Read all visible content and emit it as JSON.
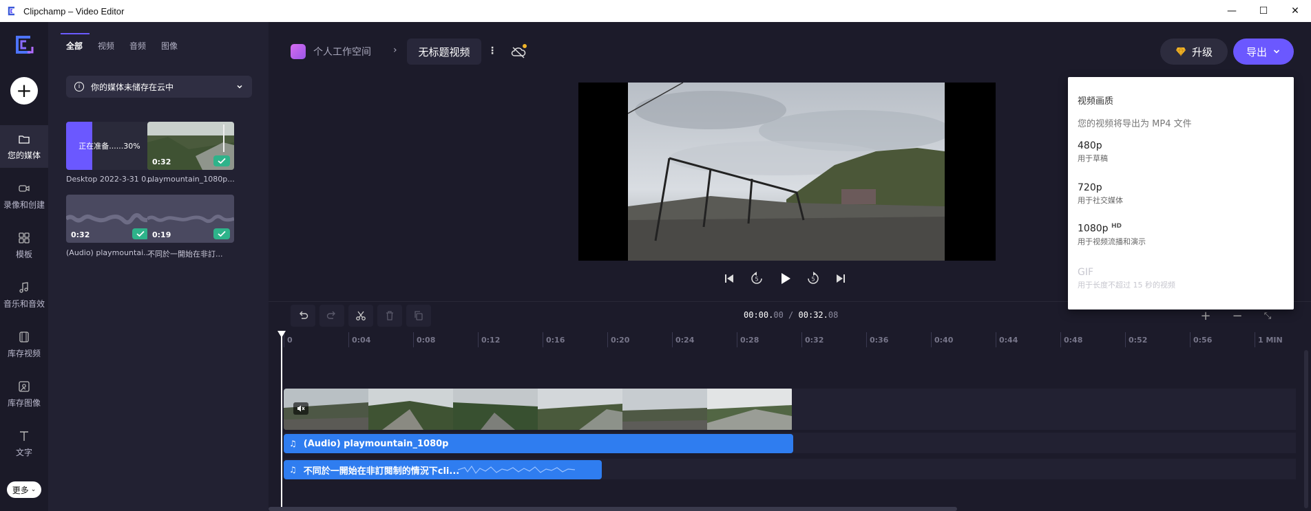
{
  "window": {
    "title": "Clipchamp – Video Editor",
    "minimize": "—",
    "maximize": "☐",
    "close": "✕"
  },
  "rail": {
    "items": [
      {
        "label": "您的媒体",
        "icon": "folder-icon"
      },
      {
        "label": "录像和创建",
        "icon": "camera-icon"
      },
      {
        "label": "模板",
        "icon": "templates-icon"
      },
      {
        "label": "音乐和音效",
        "icon": "music-icon"
      },
      {
        "label": "库存视频",
        "icon": "film-icon"
      },
      {
        "label": "库存图像",
        "icon": "image-icon"
      },
      {
        "label": "文字",
        "icon": "text-icon"
      }
    ],
    "more_label": "更多"
  },
  "media": {
    "tabs": [
      "全部",
      "视频",
      "音频",
      "图像"
    ],
    "cloud_banner": "你的媒体未储存在云中",
    "items": [
      {
        "caption": "Desktop 2022-3-31 0...",
        "status": "正在准备......30%",
        "progress": 0.3
      },
      {
        "caption": "playmountain_1080p....",
        "duration": "0:32"
      },
      {
        "caption": "(Audio) playmountai...",
        "duration": "0:32"
      },
      {
        "caption": "不同於一開始在非訂...",
        "duration": "0:19"
      }
    ]
  },
  "header": {
    "workspace": "个人工作空间",
    "separator": "›",
    "project_title": "无标题视频",
    "kebab": "⋮",
    "upgrade_label": "升级",
    "export_label": "导出"
  },
  "export_menu": {
    "heading": "视频画质",
    "subheading": "您的视频将导出为 MP4 文件",
    "options": [
      {
        "res": "480p",
        "desc": "用于草稿",
        "badge": ""
      },
      {
        "res": "720p",
        "desc": "用于社交媒体",
        "badge": ""
      },
      {
        "res": "1080p",
        "desc": "用于视频流播和演示",
        "badge": "HD"
      },
      {
        "res": "GIF",
        "desc": "用于长度不超过 15 秒的视频",
        "badge": ""
      }
    ]
  },
  "timeline": {
    "current": "00:00.",
    "current_frac": "00",
    "sep": "/",
    "total": "00:32.",
    "total_frac": "08",
    "ticks": [
      "0",
      "0:04",
      "0:08",
      "0:12",
      "0:16",
      "0:20",
      "0:24",
      "0:28",
      "0:32",
      "0:36",
      "0:40",
      "0:44",
      "0:48",
      "0:52",
      "0:56",
      "1 MIN"
    ],
    "audio_track_1": "(Audio) playmountain_1080p",
    "audio_track_2": "不同於一開始在非訂閱制的情況下cli..."
  },
  "colors": {
    "accent": "#6b58ff",
    "audio": "#2f7df0",
    "success": "#2eb38a"
  }
}
